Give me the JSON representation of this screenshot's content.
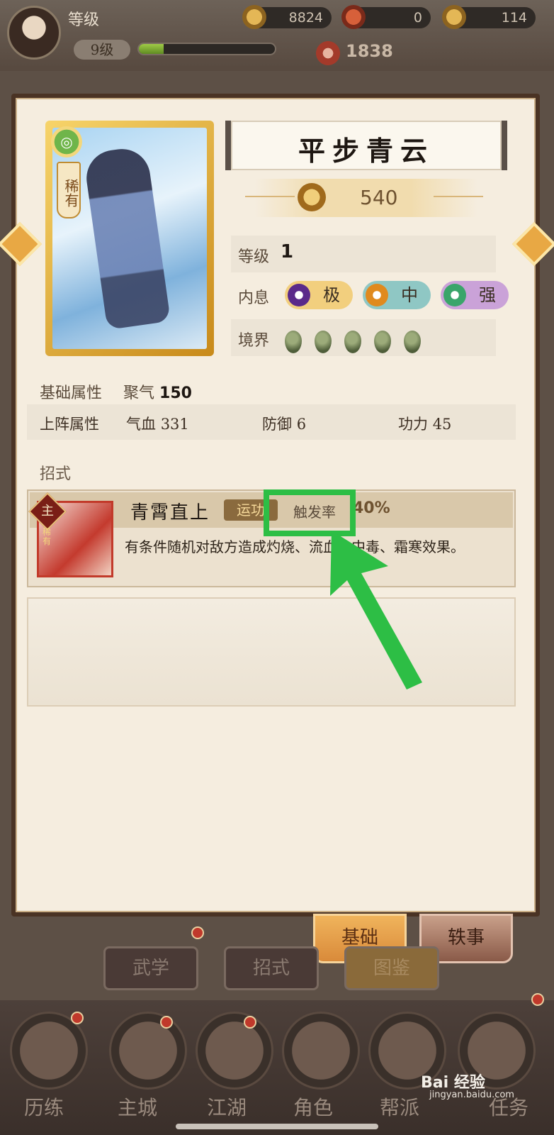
{
  "topbar": {
    "level_title": "等级",
    "level_pill": "9级",
    "exp_progress": 0.18,
    "gold": "8824",
    "currency2": "0",
    "ingot": "114",
    "power": "1838"
  },
  "card": {
    "rarity_label": "稀有"
  },
  "skill_book": {
    "name": "平步青云",
    "value": "540",
    "attrs": {
      "level_label": "等级",
      "level_value": "1",
      "neixi_label": "内息",
      "neixi_pills": [
        {
          "label": "极",
          "color": "#f2cf7e",
          "dot": "#5b2a8a"
        },
        {
          "label": "中",
          "color": "#8fc7c4",
          "dot": "#e08a1e"
        },
        {
          "label": "强",
          "color": "#caa2d8",
          "dot": "#3aa56a"
        }
      ],
      "realm_label": "境界"
    }
  },
  "base": {
    "label": "基础属性",
    "stat_name": "聚气",
    "stat_value": "150"
  },
  "deploy": {
    "label": "上阵属性",
    "stats": [
      {
        "name": "气血",
        "value": "331"
      },
      {
        "name": "防御",
        "value": "6"
      },
      {
        "name": "功力",
        "value": "45"
      }
    ]
  },
  "moves": {
    "label": "招式",
    "skill": {
      "badge": "主",
      "icon_rarity": "稀有",
      "name": "青霄直上",
      "tag": "运功",
      "trigger_label": "触发率",
      "trigger_value": "40%",
      "description": "有条件随机对敌方造成灼烧、流血、中毒、霜寒效果。"
    }
  },
  "tabs": {
    "basic": "基础",
    "anecdote": "轶事"
  },
  "subtabs": [
    "武学",
    "招式",
    "图鉴"
  ],
  "dock": [
    "历练",
    "主城",
    "江湖",
    "角色",
    "帮派",
    "任务"
  ],
  "watermark": {
    "title": "Bai 经验",
    "url": "jingyan.baidu.com"
  },
  "colors": {
    "highlight": "#2dbe45",
    "dialog_bg": "#f5eddf",
    "accent_gold": "#e8a844"
  }
}
